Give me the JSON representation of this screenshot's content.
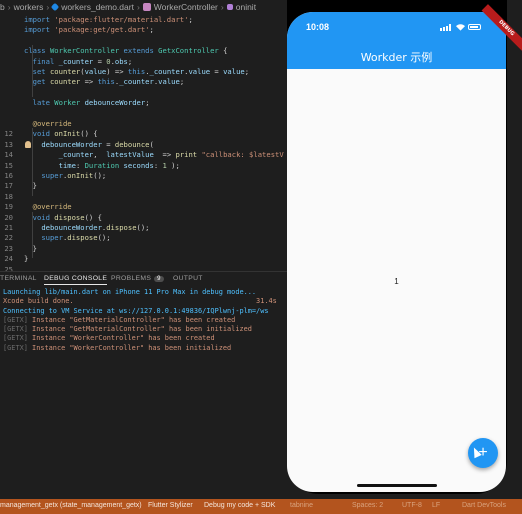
{
  "breadcrumb": [
    "b",
    "workers",
    "workers_demo.dart",
    "WorkerController",
    "oninit"
  ],
  "editor": {
    "lines": [
      {
        "n": "",
        "tokens": [
          {
            "t": "kw",
            "v": "import "
          },
          {
            "t": "str",
            "v": "'package:flutter/material.dart'"
          },
          {
            "t": "pl",
            "v": ";"
          }
        ]
      },
      {
        "n": "",
        "tokens": [
          {
            "t": "kw",
            "v": "import "
          },
          {
            "t": "str",
            "v": "'package:get/get.dart'"
          },
          {
            "t": "pl",
            "v": ";"
          }
        ]
      },
      {
        "n": "",
        "tokens": []
      },
      {
        "n": "",
        "tokens": [
          {
            "t": "kw",
            "v": "class "
          },
          {
            "t": "cls",
            "v": "WorkerController "
          },
          {
            "t": "kw",
            "v": "extends "
          },
          {
            "t": "cls",
            "v": "GetxController"
          },
          {
            "t": "pl",
            "v": " {"
          }
        ]
      },
      {
        "n": "",
        "tokens": [
          {
            "t": "pl",
            "v": "  "
          },
          {
            "t": "kw",
            "v": "final "
          },
          {
            "t": "var",
            "v": "_counter"
          },
          {
            "t": "pl",
            "v": " = "
          },
          {
            "t": "num",
            "v": "0"
          },
          {
            "t": "pl",
            "v": "."
          },
          {
            "t": "var",
            "v": "obs"
          },
          {
            "t": "pl",
            "v": ";"
          }
        ]
      },
      {
        "n": "",
        "tokens": [
          {
            "t": "pl",
            "v": "  "
          },
          {
            "t": "kw",
            "v": "set "
          },
          {
            "t": "fn",
            "v": "counter"
          },
          {
            "t": "pl",
            "v": "("
          },
          {
            "t": "var",
            "v": "value"
          },
          {
            "t": "pl",
            "v": ") => "
          },
          {
            "t": "kw",
            "v": "this"
          },
          {
            "t": "pl",
            "v": "."
          },
          {
            "t": "var",
            "v": "_counter"
          },
          {
            "t": "pl",
            "v": "."
          },
          {
            "t": "var",
            "v": "value"
          },
          {
            "t": "pl",
            "v": " = "
          },
          {
            "t": "var",
            "v": "value"
          },
          {
            "t": "pl",
            "v": ";"
          }
        ]
      },
      {
        "n": "",
        "tokens": [
          {
            "t": "pl",
            "v": "  "
          },
          {
            "t": "kw",
            "v": "get "
          },
          {
            "t": "fn",
            "v": "counter"
          },
          {
            "t": "pl",
            "v": " => "
          },
          {
            "t": "kw",
            "v": "this"
          },
          {
            "t": "pl",
            "v": "."
          },
          {
            "t": "var",
            "v": "_counter"
          },
          {
            "t": "pl",
            "v": "."
          },
          {
            "t": "var",
            "v": "value"
          },
          {
            "t": "pl",
            "v": ";"
          }
        ]
      },
      {
        "n": "",
        "tokens": []
      },
      {
        "n": "",
        "tokens": [
          {
            "t": "pl",
            "v": "  "
          },
          {
            "t": "kw",
            "v": "late "
          },
          {
            "t": "cls",
            "v": "Worker "
          },
          {
            "t": "var",
            "v": "debounceWorder"
          },
          {
            "t": "pl",
            "v": ";"
          }
        ]
      },
      {
        "n": "",
        "tokens": []
      },
      {
        "n": "",
        "tokens": [
          {
            "t": "pl",
            "v": "  "
          },
          {
            "t": "meta",
            "v": "@override"
          }
        ]
      },
      {
        "n": "12",
        "tokens": [
          {
            "t": "pl",
            "v": "  "
          },
          {
            "t": "kw",
            "v": "void "
          },
          {
            "t": "fn",
            "v": "onInit"
          },
          {
            "t": "pl",
            "v": "() {"
          }
        ]
      },
      {
        "n": "13",
        "tokens": [
          {
            "t": "pl",
            "v": "    "
          },
          {
            "t": "var",
            "v": "debounceWorder"
          },
          {
            "t": "pl",
            "v": " = "
          },
          {
            "t": "fn",
            "v": "debounce"
          },
          {
            "t": "pl",
            "v": "("
          }
        ]
      },
      {
        "n": "14",
        "tokens": [
          {
            "t": "pl",
            "v": "        "
          },
          {
            "t": "var",
            "v": "_counter"
          },
          {
            "t": "pl",
            "v": ",  "
          },
          {
            "t": "var",
            "v": "latestValue"
          },
          {
            "t": "pl",
            "v": "  => "
          },
          {
            "t": "fn",
            "v": "print"
          },
          {
            "t": "pl",
            "v": " "
          },
          {
            "t": "str",
            "v": "\"callback: $latestV"
          }
        ]
      },
      {
        "n": "15",
        "tokens": [
          {
            "t": "pl",
            "v": "        "
          },
          {
            "t": "var",
            "v": "time"
          },
          {
            "t": "pl",
            "v": ": "
          },
          {
            "t": "cls",
            "v": "Duration"
          },
          {
            "t": "pl",
            "v": " "
          },
          {
            "t": "var",
            "v": "seconds"
          },
          {
            "t": "pl",
            "v": ": "
          },
          {
            "t": "num",
            "v": "1"
          },
          {
            "t": "pl",
            "v": " );"
          }
        ]
      },
      {
        "n": "16",
        "tokens": [
          {
            "t": "pl",
            "v": "    "
          },
          {
            "t": "kw",
            "v": "super"
          },
          {
            "t": "pl",
            "v": "."
          },
          {
            "t": "fn",
            "v": "onInit"
          },
          {
            "t": "pl",
            "v": "();"
          }
        ]
      },
      {
        "n": "17",
        "tokens": [
          {
            "t": "pl",
            "v": "  }"
          }
        ]
      },
      {
        "n": "18",
        "tokens": []
      },
      {
        "n": "19",
        "tokens": [
          {
            "t": "pl",
            "v": "  "
          },
          {
            "t": "meta",
            "v": "@override"
          }
        ]
      },
      {
        "n": "20",
        "tokens": [
          {
            "t": "pl",
            "v": "  "
          },
          {
            "t": "kw",
            "v": "void "
          },
          {
            "t": "fn",
            "v": "dispose"
          },
          {
            "t": "pl",
            "v": "() {"
          }
        ]
      },
      {
        "n": "21",
        "tokens": [
          {
            "t": "pl",
            "v": "    "
          },
          {
            "t": "var",
            "v": "debounceWorder"
          },
          {
            "t": "pl",
            "v": "."
          },
          {
            "t": "fn",
            "v": "dispose"
          },
          {
            "t": "pl",
            "v": "();"
          }
        ]
      },
      {
        "n": "22",
        "tokens": [
          {
            "t": "pl",
            "v": "    "
          },
          {
            "t": "kw",
            "v": "super"
          },
          {
            "t": "pl",
            "v": "."
          },
          {
            "t": "fn",
            "v": "dispose"
          },
          {
            "t": "pl",
            "v": "();"
          }
        ]
      },
      {
        "n": "23",
        "tokens": [
          {
            "t": "pl",
            "v": "  }"
          }
        ]
      },
      {
        "n": "24",
        "tokens": [
          {
            "t": "pl",
            "v": "}"
          }
        ]
      },
      {
        "n": "25",
        "tokens": []
      }
    ]
  },
  "panel": {
    "tabs": [
      "TERMINAL",
      "DEBUG CONSOLE",
      "PROBLEMS",
      "OUTPUT"
    ],
    "problems_count": "9",
    "console": [
      {
        "style": "con-blue",
        "text": "Launching lib/main.dart on iPhone 11 Pro Max in debug mode..."
      },
      {
        "style": "con-orange",
        "text": "Xcode build done.                                            31.4s"
      },
      {
        "style": "con-blue",
        "text": "Connecting to VM Service at ws://127.0.0.1:49836/IQPlwnj-plm=/ws"
      },
      {
        "style": "con-orange",
        "prefix": "[GETX]",
        "text": " Instance \"GetMaterialController\" has been created"
      },
      {
        "style": "con-orange",
        "prefix": "[GETX]",
        "text": " Instance \"GetMaterialController\" has been initialized"
      },
      {
        "style": "con-orange",
        "prefix": "[GETX]",
        "text": " Instance \"WorkerController\" has been created"
      },
      {
        "style": "con-orange",
        "prefix": "[GETX]",
        "text": " Instance \"WorkerController\" has been initialized"
      }
    ]
  },
  "statusbar": {
    "items": [
      {
        "text": "management_getx (state_management_getx)",
        "dim": false
      },
      {
        "text": "Flutter Stylizer",
        "dim": false
      },
      {
        "text": "Debug my code + SDK",
        "dim": false
      },
      {
        "text": "tabnine",
        "dim": true
      },
      {
        "text": "Spaces: 2",
        "dim": true
      },
      {
        "text": "UTF-8",
        "dim": true
      },
      {
        "text": "LF",
        "dim": true
      },
      {
        "text": "Dart DevTools",
        "dim": true
      }
    ]
  },
  "phone": {
    "time": "10:08",
    "app_title": "Workder 示例",
    "counter": "1",
    "fab_label": "+",
    "debug_banner": "DEBUG"
  },
  "colors": {
    "appbar": "#2196f3",
    "statusbar": "#b3541e",
    "editor_bg": "#1e1e1e"
  }
}
